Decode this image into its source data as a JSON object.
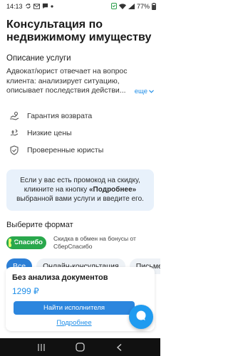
{
  "status_bar": {
    "time": "14:13",
    "battery": "77%",
    "left_icons": [
      "sync-icon",
      "mail-icon",
      "chat-icon",
      "dot-icon"
    ],
    "right_icons": [
      "alarm-icon",
      "wifi-icon",
      "signal-icon",
      "battery-icon"
    ]
  },
  "header": {
    "title": "Консультация по недвижимому имуществу"
  },
  "description": {
    "heading": "Описание услуги",
    "text": "Адвокат/юрист отвечает на вопрос клиента: анализирует ситуацию, описывает последствия действи...",
    "more_label": "еще"
  },
  "features": [
    {
      "icon": "refund-icon",
      "label": "Гарантия возврата"
    },
    {
      "icon": "low-price-icon",
      "label": "Низкие цены"
    },
    {
      "icon": "verified-shield-icon",
      "label": "Проверенные юристы"
    }
  ],
  "promo": {
    "text_before": "Если у вас есть промокод на скидку, кликните на кнопку ",
    "link_text": "«Подробнее»",
    "text_after": " выбранной вами услуги и введите его."
  },
  "format": {
    "heading": "Выберите формат",
    "sber_badge": "Спасибо",
    "sber_text": "Скидка в обмен на бонусы от СберСпасибо",
    "tabs": [
      {
        "label": "Все",
        "active": true
      },
      {
        "label": "Онлайн-консультация",
        "active": false
      },
      {
        "label": "Письменная",
        "active": false
      }
    ]
  },
  "card": {
    "title": "Без анализа документов",
    "price": "1299 ₽",
    "button_label": "Найти исполнителя",
    "more_label": "Подробнее"
  },
  "colors": {
    "accent": "#2c86de",
    "link": "#1f8ee8",
    "promo_bg": "#e8f1fb",
    "sber_green": "#29a84c"
  }
}
